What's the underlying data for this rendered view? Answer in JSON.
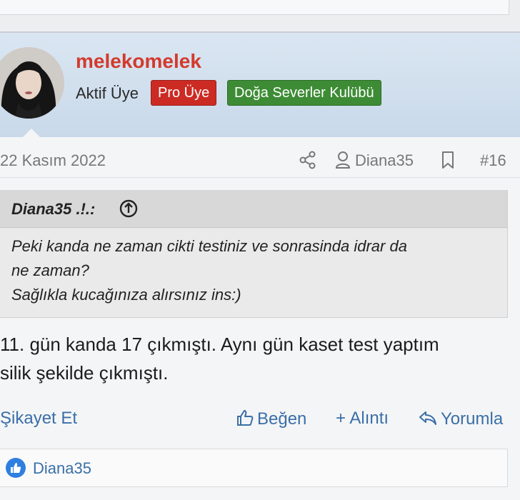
{
  "user": {
    "name": "melekomelek",
    "title": "Aktif Üye",
    "badges": [
      "Pro Üye",
      "Doğa Severler Kulübü"
    ]
  },
  "post": {
    "date": "22 Kasım 2022",
    "attribution_user": "Diana35",
    "number": "#16",
    "quote": {
      "author": "Diana35 .!.:",
      "text": "Peki kanda ne zaman cikti testiniz ve sonrasinda idrar da\nne zaman?\nSağlıkla kucağınıza alırsınız ins:)"
    },
    "body": "11. gün kanda 17 çıkmıştı. Aynı gün kaset test yaptım\nsilik şekilde çıkmıştı."
  },
  "actions": {
    "report": "Şikayet Et",
    "like": "Beğen",
    "quote": "+ Alıntı",
    "reply": "Yorumla"
  },
  "reactions": {
    "user": "Diana35"
  },
  "colors": {
    "username": "#d33a2c",
    "badge_pro": "#cc2b24",
    "badge_club": "#3d8c35",
    "link": "#3a6fa8",
    "header_bg": "#d3e1ef"
  }
}
